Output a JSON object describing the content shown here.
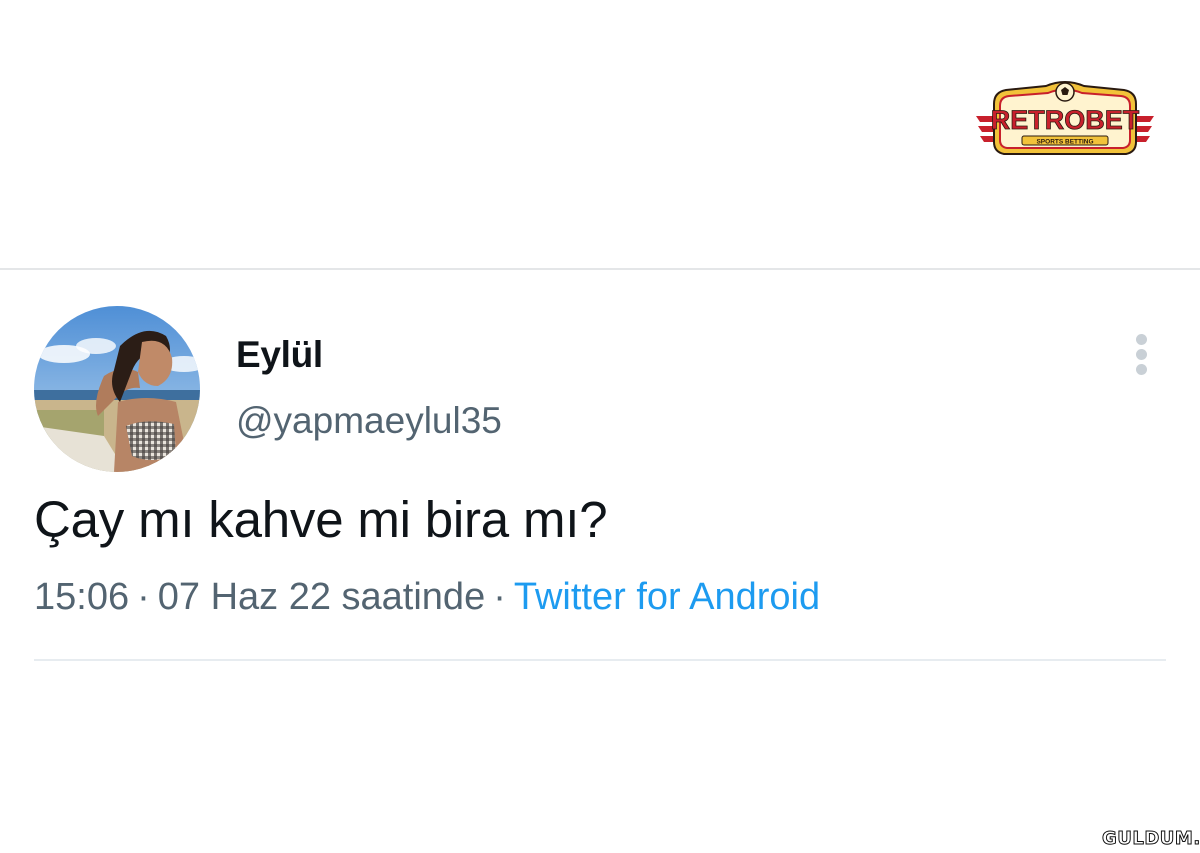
{
  "logo": {
    "text": "RETROBET",
    "tagline": "SPORTS BETTING",
    "colors": {
      "red": "#c8202c",
      "gold": "#f2c23a",
      "cream": "#fff3cf",
      "dark": "#2a1a10"
    }
  },
  "tweet": {
    "display_name": "Eylül",
    "handle": "@yapmaeylul35",
    "text": "Çay mı kahve mi bira mı?",
    "time": "15:06",
    "date_text": "07 Haz 22 saatinde",
    "separator": "·",
    "source": "Twitter for Android",
    "more_icon": "more-vertical-icon"
  },
  "watermark": {
    "text": "GULDUM.NET"
  },
  "colors": {
    "primary_text": "#0f1419",
    "secondary_text": "#536471",
    "link": "#1d9bf0",
    "divider": "#e4e6e8"
  }
}
